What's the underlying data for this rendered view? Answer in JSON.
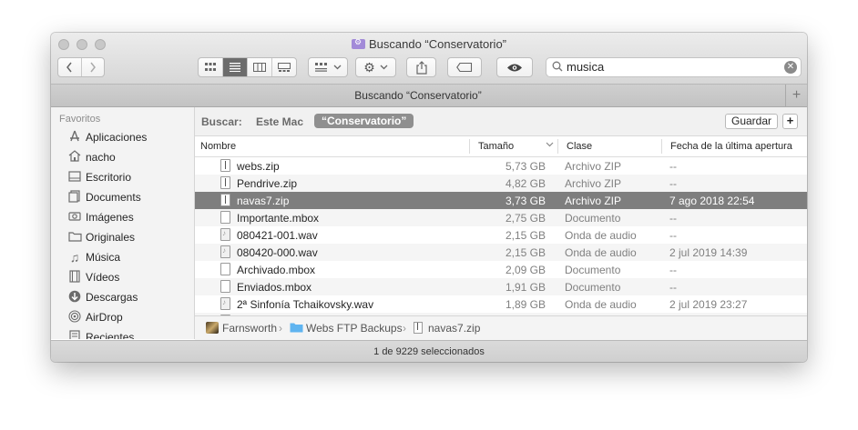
{
  "window": {
    "title": "Buscando “Conservatorio”",
    "tab_title": "Buscando “Conservatorio”",
    "status": "1 de 9229 seleccionados"
  },
  "toolbar": {
    "back_icon": "chevron-left-icon",
    "forward_icon": "chevron-right-icon",
    "view_modes": [
      "icon-view-icon",
      "list-view-icon",
      "column-view-icon",
      "gallery-view-icon"
    ],
    "search_query": "musica"
  },
  "sidebar": {
    "header": "Favoritos",
    "items": [
      {
        "label": "Aplicaciones",
        "icon": "applications-icon"
      },
      {
        "label": "nacho",
        "icon": "home-icon"
      },
      {
        "label": "Escritorio",
        "icon": "desktop-icon"
      },
      {
        "label": "Documents",
        "icon": "documents-icon"
      },
      {
        "label": "Imágenes",
        "icon": "camera-icon"
      },
      {
        "label": "Originales",
        "icon": "folder-icon"
      },
      {
        "label": "Música",
        "icon": "music-icon"
      },
      {
        "label": "Vídeos",
        "icon": "film-icon"
      },
      {
        "label": "Descargas",
        "icon": "downloads-icon"
      },
      {
        "label": "AirDrop",
        "icon": "airdrop-icon"
      },
      {
        "label": "Recientes",
        "icon": "recents-icon"
      }
    ]
  },
  "scope": {
    "label": "Buscar:",
    "this_mac": "Este Mac",
    "selected": "“Conservatorio”",
    "save": "Guardar",
    "add": "+"
  },
  "columns": {
    "name": "Nombre",
    "size": "Tamaño",
    "kind": "Clase",
    "date": "Fecha de la última apertura"
  },
  "files": [
    {
      "name": "webs.zip",
      "size": "5,73 GB",
      "kind": "Archivo ZIP",
      "date": "--",
      "type": "zip"
    },
    {
      "name": "Pendrive.zip",
      "size": "4,82 GB",
      "kind": "Archivo ZIP",
      "date": "--",
      "type": "zip"
    },
    {
      "name": "navas7.zip",
      "size": "3,73 GB",
      "kind": "Archivo ZIP",
      "date": "7 ago 2018 22:54",
      "type": "zip",
      "selected": true
    },
    {
      "name": "Importante.mbox",
      "size": "2,75 GB",
      "kind": "Documento",
      "date": "--",
      "type": "doc"
    },
    {
      "name": "080421-001.wav",
      "size": "2,15 GB",
      "kind": "Onda de audio",
      "date": "--",
      "type": "audio"
    },
    {
      "name": "080420-000.wav",
      "size": "2,15 GB",
      "kind": "Onda de audio",
      "date": "2 jul 2019 14:39",
      "type": "audio"
    },
    {
      "name": "Archivado.mbox",
      "size": "2,09 GB",
      "kind": "Documento",
      "date": "--",
      "type": "doc"
    },
    {
      "name": "Enviados.mbox",
      "size": "1,91 GB",
      "kind": "Documento",
      "date": "--",
      "type": "doc"
    },
    {
      "name": "2ª Sinfonía Tchaikovsky.wav",
      "size": "1,89 GB",
      "kind": "Onda de audio",
      "date": "2 jul 2019 23:27",
      "type": "audio"
    }
  ],
  "path": [
    "Farnsworth",
    "Webs FTP Backups",
    "navas7.zip"
  ],
  "colors": {
    "selection": "#7e7e7e",
    "scope_selected": "#8f8f8f",
    "folder_blue": "#5fb4f0",
    "tab_folder": "#a28ad8"
  }
}
